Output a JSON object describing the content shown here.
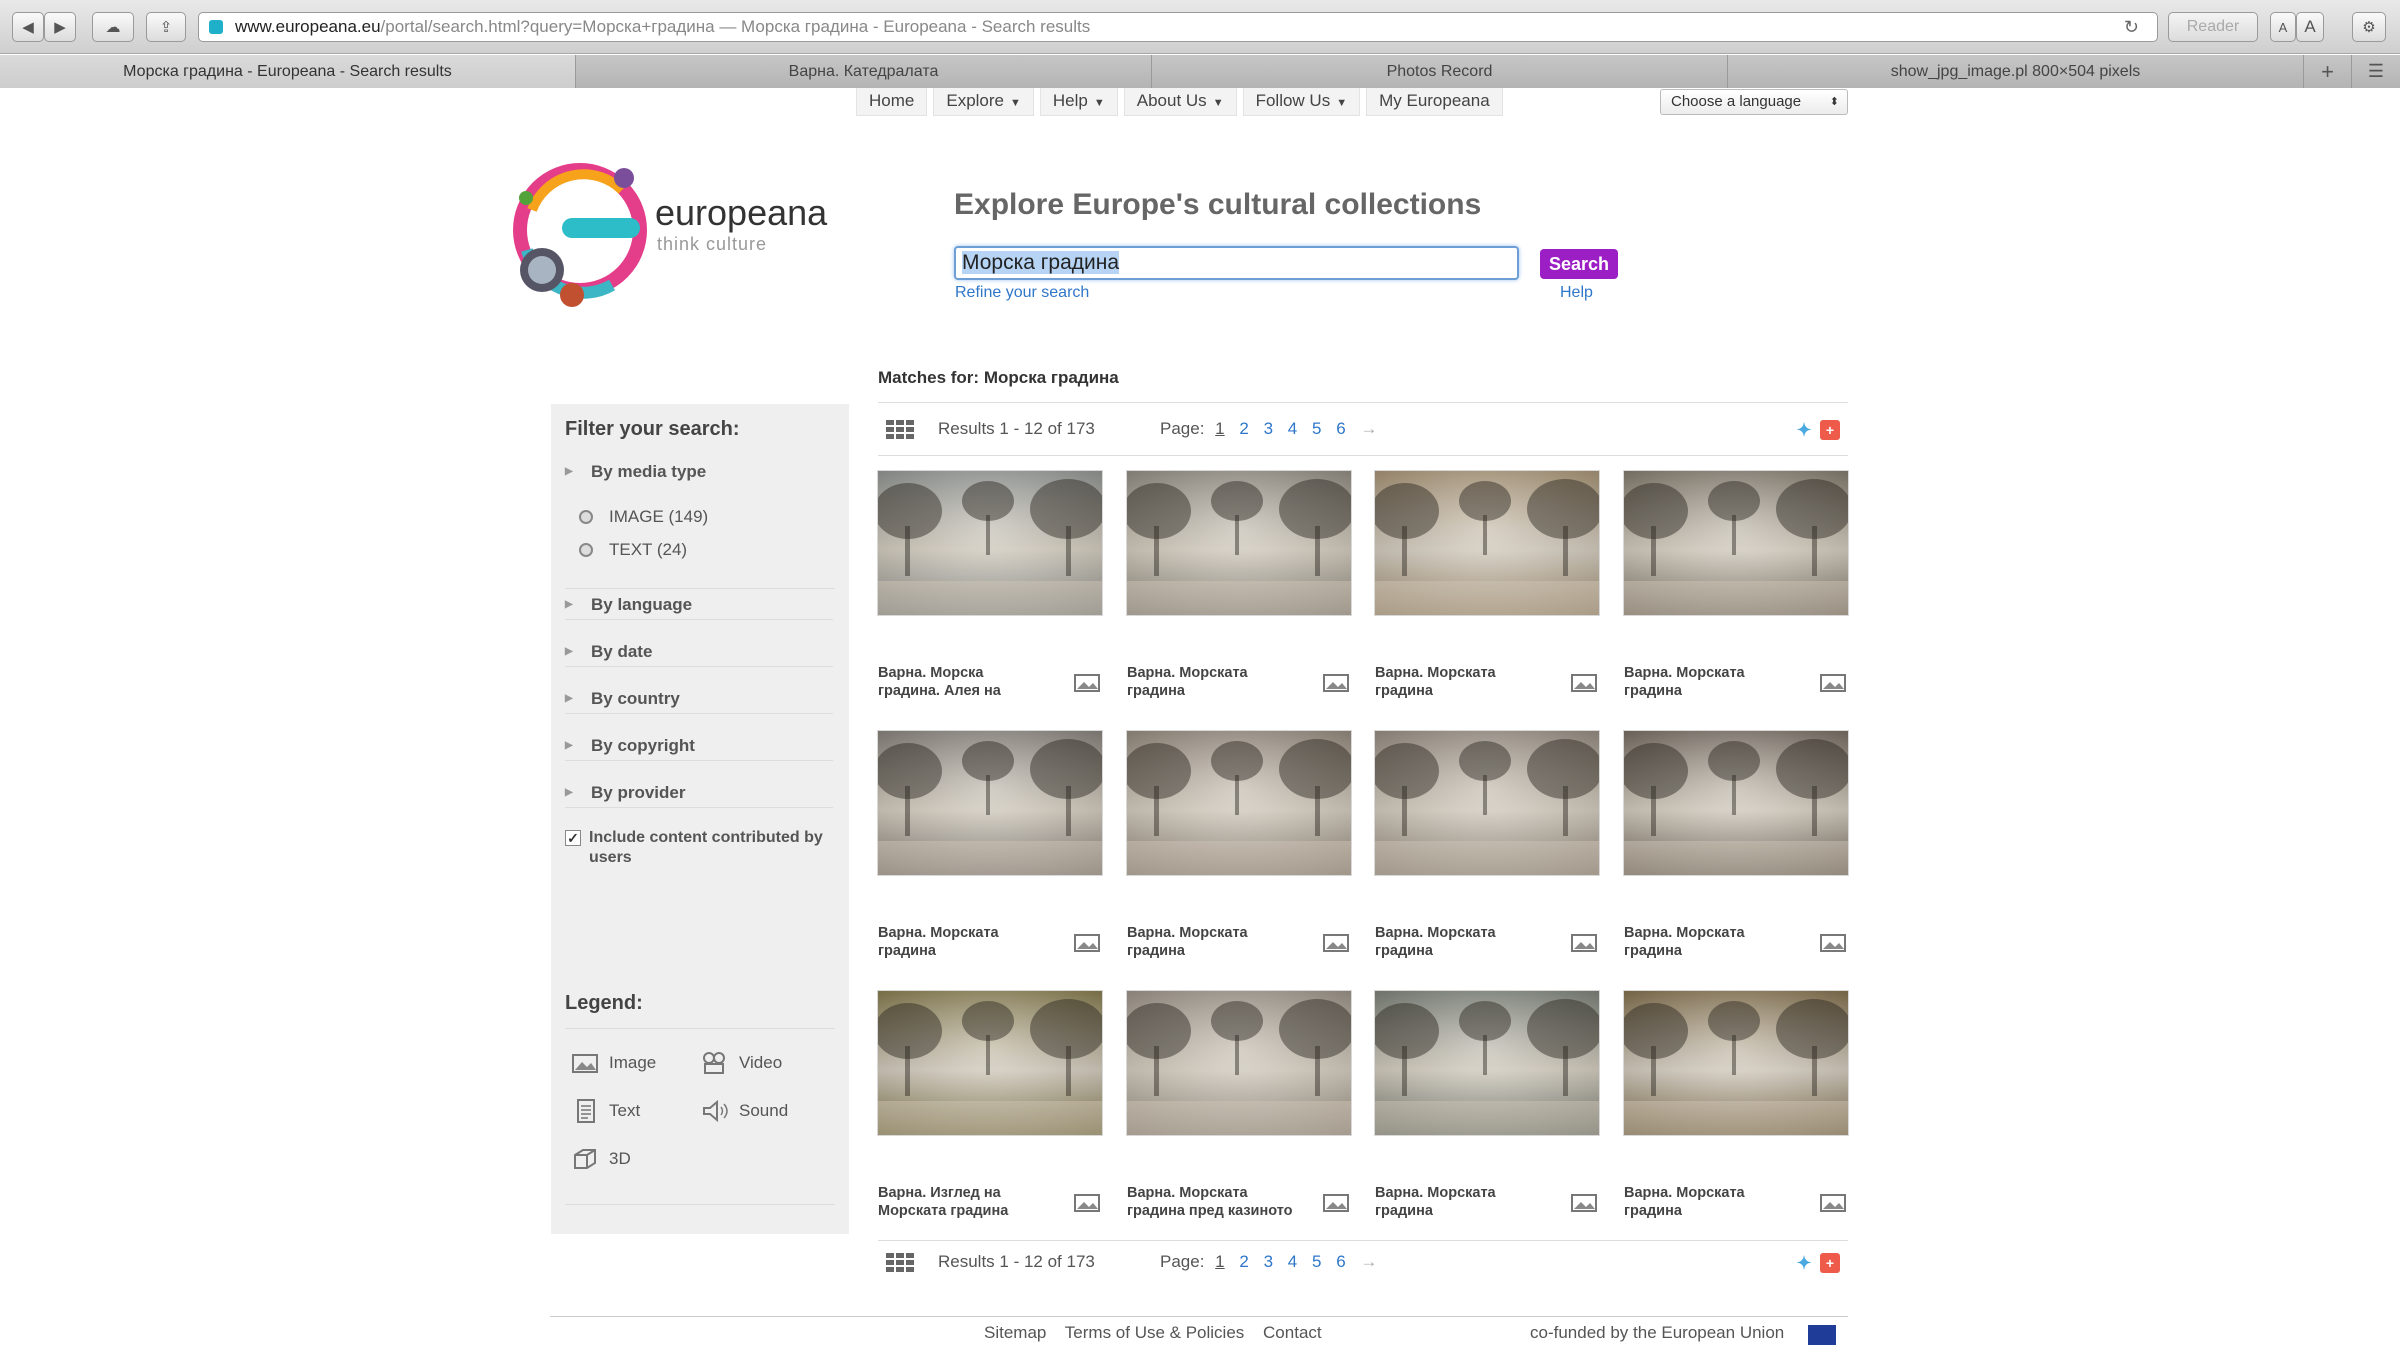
{
  "browser": {
    "url_main": "www.europeana.eu",
    "url_rest": "/portal/search.html?query=Морска+градина — Морска градина - Europeana - Search results",
    "reader_label": "Reader",
    "tabs": [
      {
        "label": "Морска градина - Europeana - Search results",
        "active": true
      },
      {
        "label": "Варна. Катедралата",
        "active": false
      },
      {
        "label": "Photos Record",
        "active": false
      },
      {
        "label": "show_jpg_image.pl 800×504 pixels",
        "active": false
      }
    ],
    "new_tab": "+"
  },
  "nav": {
    "home": "Home",
    "explore": "Explore",
    "help": "Help",
    "about": "About Us",
    "follow": "Follow Us",
    "my": "My Europeana",
    "language": "Choose a language"
  },
  "logo": {
    "brand": "europeana",
    "tagline": "think culture"
  },
  "search": {
    "headline": "Explore Europe's cultural collections",
    "query": "Морска градина",
    "button": "Search",
    "refine": "Refine your search",
    "help": "Help"
  },
  "sidebar": {
    "filter_title": "Filter your search:",
    "facets": {
      "media_type": "By media type",
      "language": "By language",
      "date": "By date",
      "country": "By country",
      "copyright": "By copyright",
      "provider": "By provider"
    },
    "media_options": [
      {
        "label": "IMAGE (149)"
      },
      {
        "label": "TEXT (24)"
      }
    ],
    "user_content": "Include content contributed by users",
    "legend_title": "Legend:",
    "legend": {
      "image": "Image",
      "video": "Video",
      "text": "Text",
      "sound": "Sound",
      "3d": "3D"
    }
  },
  "results": {
    "matches_label": "Matches for:",
    "matches_query": "Морска градина",
    "summary": "Results 1 - 12 of 173",
    "page_label": "Page:",
    "pages": [
      "1",
      "2",
      "3",
      "4",
      "5",
      "6"
    ],
    "current_page": "1",
    "next": "→",
    "items": [
      {
        "l1": "Варна. Морска",
        "l2": "градина. Алея на",
        "tone": "#8b8f8c"
      },
      {
        "l1": "Варна. Морската",
        "l2": "градина",
        "tone": "#8a857a"
      },
      {
        "l1": "Варна. Морската",
        "l2": "градина",
        "tone": "#a28d6d"
      },
      {
        "l1": "Варна. Морската",
        "l2": "градина",
        "tone": "#7a7264"
      },
      {
        "l1": "Варна. Морската",
        "l2": "градина",
        "tone": "#807a73"
      },
      {
        "l1": "Варна. Морската",
        "l2": "градина",
        "tone": "#8d8275"
      },
      {
        "l1": "Варна. Морската",
        "l2": "градина",
        "tone": "#8f8579"
      },
      {
        "l1": "Варна. Морската",
        "l2": "градина",
        "tone": "#6f655a"
      },
      {
        "l1": "Варна. Изглед на",
        "l2": "Морската градина",
        "tone": "#7f7444"
      },
      {
        "l1": "Варна. Морската",
        "l2": "градина пред казиното",
        "tone": "#958c80"
      },
      {
        "l1": "Варна. Морската",
        "l2": "градина",
        "tone": "#737a70"
      },
      {
        "l1": "Варна. Морската",
        "l2": "градина",
        "tone": "#7c6843"
      }
    ]
  },
  "footer": {
    "sitemap": "Sitemap",
    "terms": "Terms of Use & Policies",
    "contact": "Contact",
    "eu": "co-funded by the European Union"
  }
}
